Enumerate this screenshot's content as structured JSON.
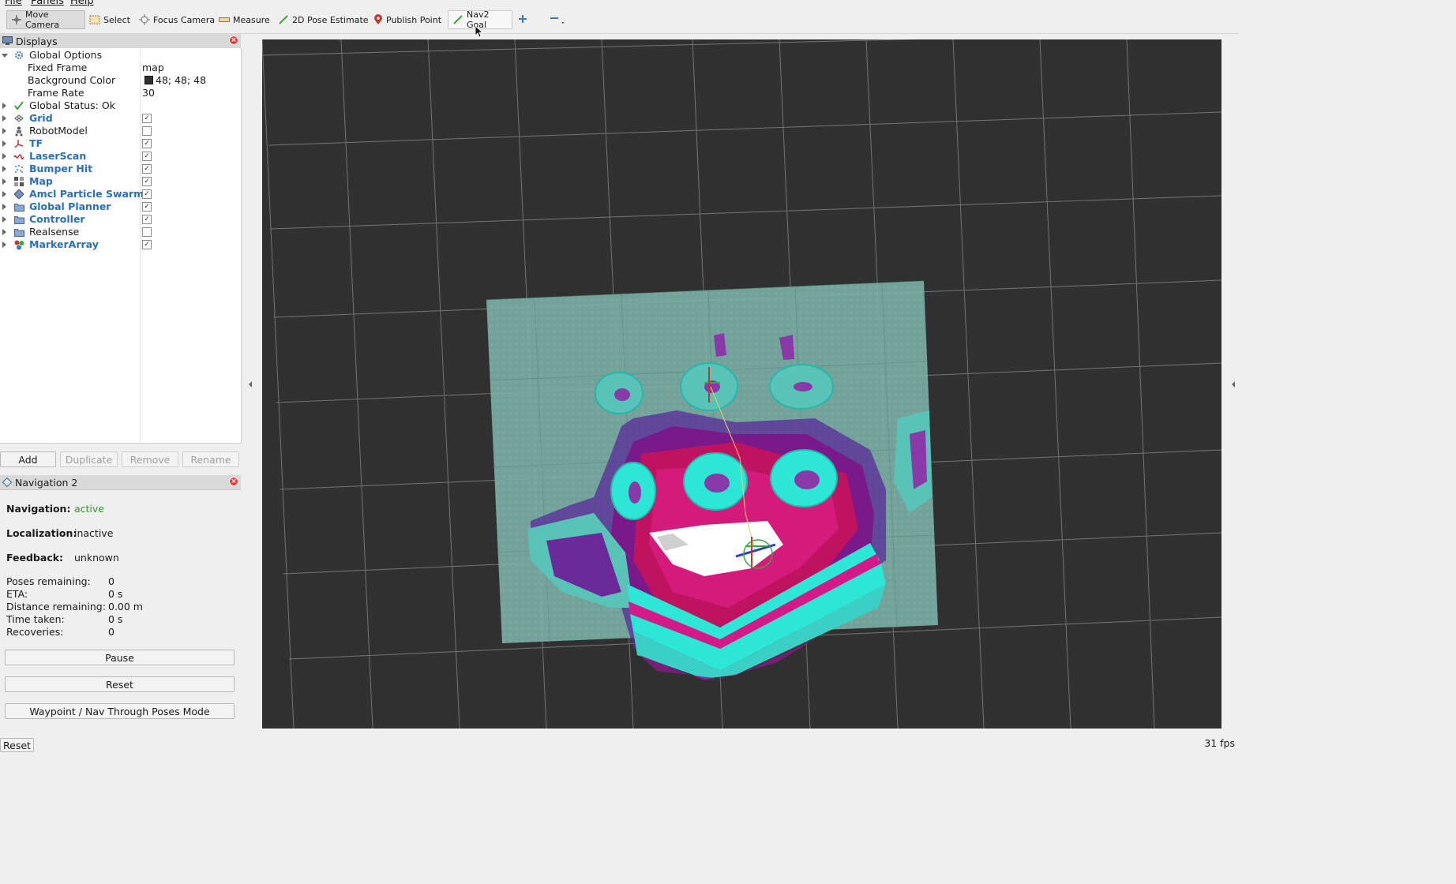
{
  "menu": [
    "File",
    "Panels",
    "Help"
  ],
  "toolbar": {
    "move_camera": "Move Camera",
    "select": "Select",
    "focus_camera": "Focus Camera",
    "measure": "Measure",
    "pose_estimate": "2D Pose Estimate",
    "publish_point": "Publish Point",
    "nav2_goal": "Nav2 Goal"
  },
  "displays": {
    "title": "Displays",
    "global_options": "Global Options",
    "fixed_frame_label": "Fixed Frame",
    "fixed_frame_value": "map",
    "bg_color_label": "Background Color",
    "bg_color_value": "48; 48; 48",
    "bg_color_swatch": "#303030",
    "frame_rate_label": "Frame Rate",
    "frame_rate_value": "30",
    "global_status": "Global Status: Ok",
    "items": [
      {
        "label": "Grid",
        "enabled": true
      },
      {
        "label": "RobotModel",
        "enabled": false
      },
      {
        "label": "TF",
        "enabled": true
      },
      {
        "label": "LaserScan",
        "enabled": true
      },
      {
        "label": "Bumper Hit",
        "enabled": true
      },
      {
        "label": "Map",
        "enabled": true
      },
      {
        "label": "Amcl Particle Swarm",
        "enabled": true
      },
      {
        "label": "Global Planner",
        "enabled": true
      },
      {
        "label": "Controller",
        "enabled": true
      },
      {
        "label": "Realsense",
        "enabled": false
      },
      {
        "label": "MarkerArray",
        "enabled": true
      }
    ],
    "buttons": {
      "add": "Add",
      "duplicate": "Duplicate",
      "remove": "Remove",
      "rename": "Rename"
    }
  },
  "nav": {
    "title": "Navigation 2",
    "navigation_label": "Navigation:",
    "navigation_value": "active",
    "localization_label": "Localization:",
    "localization_value": "inactive",
    "feedback_label": "Feedback:",
    "feedback_value": "unknown",
    "stats": [
      {
        "label": "Poses remaining:",
        "value": "0"
      },
      {
        "label": "ETA:",
        "value": "0 s"
      },
      {
        "label": "Distance remaining:",
        "value": "0.00 m"
      },
      {
        "label": "Time taken:",
        "value": "0 s"
      },
      {
        "label": "Recoveries:",
        "value": "0"
      }
    ],
    "pause": "Pause",
    "reset": "Reset",
    "waypoint_mode": "Waypoint / Nav Through Poses Mode"
  },
  "status": {
    "reset": "Reset",
    "fps": "31 fps"
  },
  "colors": {
    "accent_blue": "#2a6fb7",
    "active_green": "#2c9a2c",
    "costmap_cyan": "#2ee6d6",
    "costmap_magenta": "#d4138a"
  }
}
